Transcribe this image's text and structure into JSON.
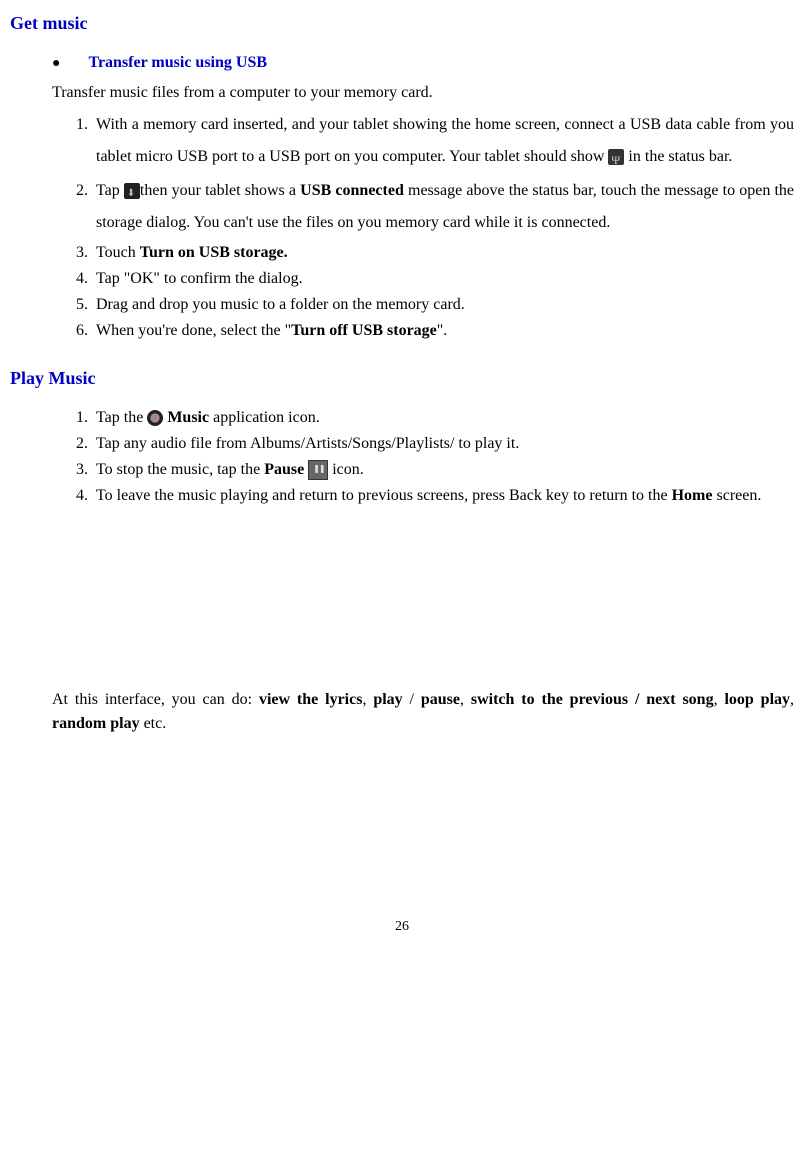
{
  "section1": {
    "title": "Get music",
    "subtitle": "Transfer music using USB",
    "intro": "Transfer music files from a computer to your memory card.",
    "items": [
      {
        "pre": "With a memory card inserted, and your tablet showing the home screen, connect a USB data cable from you tablet micro USB port to a USB port on you computer. Your tablet should show ",
        "post": " in the status bar."
      },
      {
        "pre": "Tap ",
        "mid1": "then your tablet shows a ",
        "bold1": "USB connected",
        "mid2": " message above the status bar, touch the message to open the storage dialog. You can't use the files on you memory card while it is connected."
      },
      {
        "pre": "Touch ",
        "bold1": "Turn on USB storage."
      },
      {
        "text": "Tap \"OK\" to confirm the dialog."
      },
      {
        "text": "Drag and drop you music to a folder on the memory card."
      },
      {
        "pre": "When you're done, select the \"",
        "bold1": "Turn off USB storage",
        "post": "\"."
      }
    ]
  },
  "section2": {
    "title": "Play Music",
    "items": [
      {
        "pre": "Tap the ",
        "bold1": "Music",
        "post": " application icon."
      },
      {
        "text": "Tap any audio file from Albums/Artists/Songs/Playlists/ to play it."
      },
      {
        "pre": "To stop the music, tap the ",
        "bold1": "Pause",
        "post": " icon."
      },
      {
        "pre": "To leave the music playing and return to previous screens, press Back key to return to the ",
        "bold1": "Home",
        "post": " screen."
      }
    ]
  },
  "interface": {
    "pre": "At this interface, you can do: ",
    "b1": "view the lyrics",
    "s1": ", ",
    "b2": "play",
    "s2": " / ",
    "b3": "pause",
    "s3": ", ",
    "b4": "switch to the previous / next song",
    "s4": ", ",
    "b5": "loop play",
    "s5": ", ",
    "b6": "random play",
    "post": " etc."
  },
  "pagenum": "26"
}
